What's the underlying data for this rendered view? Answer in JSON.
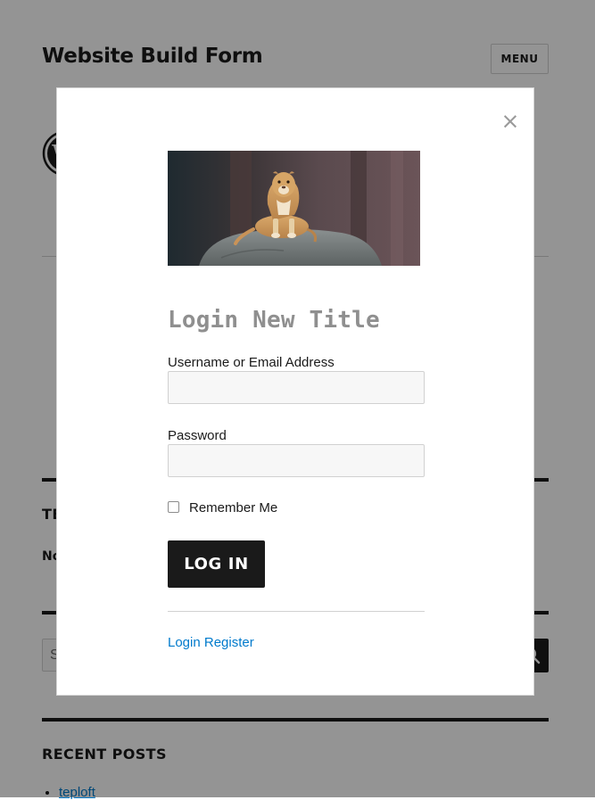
{
  "site": {
    "title": "Website Build Form",
    "menu_label": "MENU",
    "logo_icon": "wordpress-logo-icon"
  },
  "sidebar": {
    "widget_heading_partial": "TE",
    "widget_text_partial": "No",
    "search_placeholder_partial": "S",
    "search_icon": "search-icon",
    "recent_posts_heading": "RECENT POSTS",
    "recent_posts": [
      "teploft"
    ]
  },
  "modal": {
    "close_icon": "close-icon",
    "close_glyph": "×",
    "image_alt": "Lioness resting on a rock",
    "title": "Login New Title",
    "username_label": "Username or Email Address",
    "username_value": "",
    "password_label": "Password",
    "password_value": "",
    "remember_label": "Remember Me",
    "remember_checked": false,
    "login_button": "LOG IN",
    "register_link": "Login Register"
  },
  "colors": {
    "overlay": "rgba(0,0,0,0.42)",
    "link": "#007acc",
    "button_bg": "#1a1a1a",
    "title_gray": "#8f8f8f"
  }
}
